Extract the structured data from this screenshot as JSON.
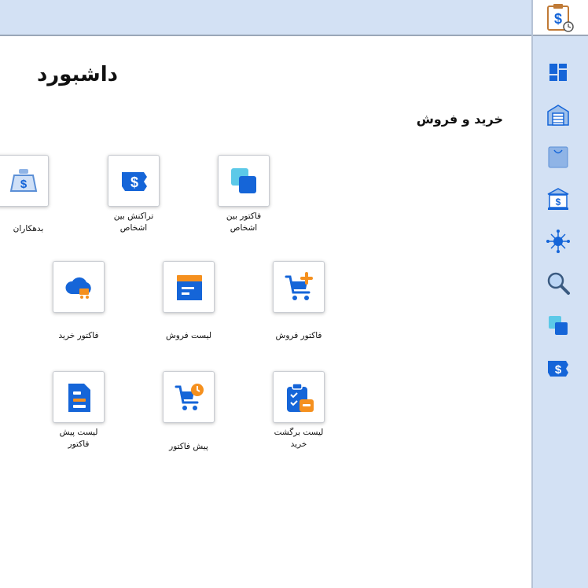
{
  "header": {
    "title": "داشبورد"
  },
  "section": {
    "title": "خرید و فروش"
  },
  "tiles": [
    {
      "label": "فاکتور بین\nاشخاص",
      "icon": "overlap-squares-icon"
    },
    {
      "label": "تراکنش بین\nاشخاص",
      "icon": "dollar-tag-icon"
    },
    {
      "label": "بدهکاران",
      "icon": "money-bag-icon"
    },
    {
      "label": "فاکتور فروش",
      "icon": "cart-plus-icon"
    },
    {
      "label": "لیست فروش",
      "icon": "archive-box-icon"
    },
    {
      "label": "فاکتور خرید",
      "icon": "cloud-cart-icon"
    },
    {
      "label": "لیست برگشت\nخرید",
      "icon": "clipboard-return-icon"
    },
    {
      "label": "پیش فاکتور",
      "icon": "cart-clock-icon"
    },
    {
      "label": "لیست پیش\nفاکتور",
      "icon": "document-list-icon"
    }
  ],
  "sidebar": {
    "items": [
      {
        "icon": "dashboard-icon"
      },
      {
        "icon": "warehouse-icon"
      },
      {
        "icon": "shopping-bag-icon"
      },
      {
        "icon": "bank-icon"
      },
      {
        "icon": "network-icon"
      },
      {
        "icon": "search-icon"
      },
      {
        "icon": "overlap-squares-icon"
      },
      {
        "icon": "dollar-tag-icon"
      }
    ]
  },
  "colors": {
    "primary": "#1565d8",
    "accent": "#f5901e",
    "sidebar_bg": "#d3e1f4"
  }
}
